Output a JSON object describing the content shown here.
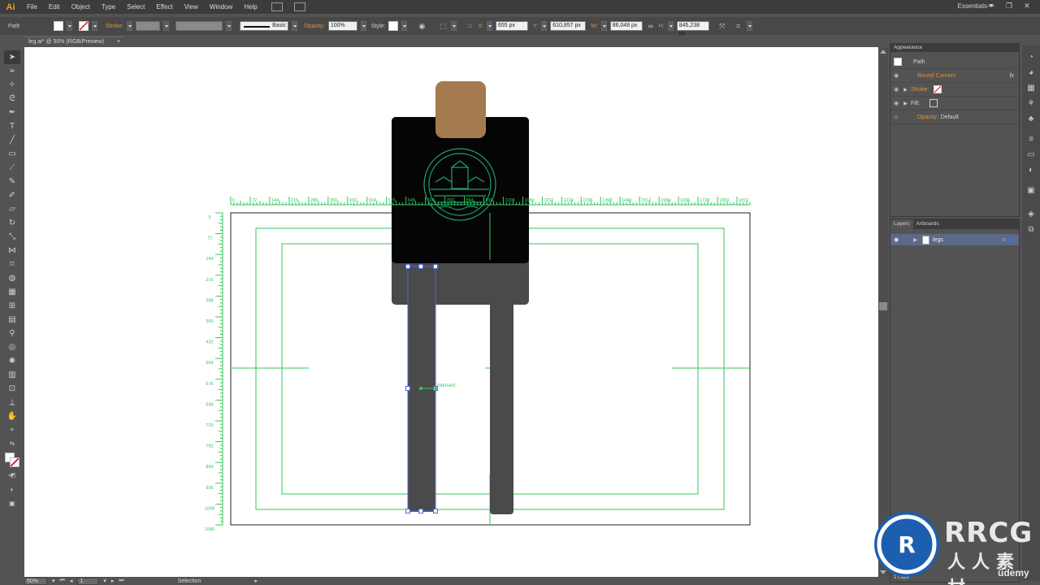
{
  "app": {
    "logo": "Ai",
    "workspace": "Essentials"
  },
  "menu": [
    "File",
    "Edit",
    "Object",
    "Type",
    "Select",
    "Effect",
    "View",
    "Window",
    "Help"
  ],
  "control": {
    "selection_type": "Path",
    "stroke_label": "Stroke:",
    "stroke_profile": "Basic",
    "opacity_label": "Opacity:",
    "opacity_value": "100%",
    "style_label": "Style:",
    "x_label": "X:",
    "x_value": "655 px",
    "y_label": "Y:",
    "y_value": "610,857 px",
    "w_label": "W:",
    "w_value": "86,048 px",
    "h_label": "H:",
    "h_value": "845,238 px"
  },
  "document": {
    "tab_title": "leg.ai* @ 50% (RGB/Preview)",
    "close": "×"
  },
  "ruler": {
    "top_ticks": [
      "0",
      "72",
      "144",
      "216",
      "288",
      "360",
      "432",
      "504",
      "576",
      "648",
      "720",
      "792",
      "864",
      "936",
      "1008",
      "1080",
      "1152",
      "1224",
      "1296",
      "1368",
      "1440",
      "1512",
      "1584",
      "1656",
      "1728",
      "1800",
      "1872"
    ],
    "left_ticks": [
      "0",
      "72",
      "144",
      "216",
      "288",
      "360",
      "432",
      "504",
      "576",
      "648",
      "720",
      "792",
      "864",
      "936",
      "1008",
      "1080"
    ],
    "smart_guide": "intersect"
  },
  "colors": {
    "guide_green": "#34c759",
    "shirt": "#050505",
    "skin": "#a57a4f",
    "pants": "#4a4a4a",
    "emblem": "#1ea371",
    "selection_blue": "#4a6bd6",
    "accent_orange": "#e0913c"
  },
  "appearance": {
    "title": "Appearance",
    "rows": [
      {
        "label": "Path"
      },
      {
        "label": "Round Corners",
        "fx": "fx"
      },
      {
        "label": "Stroke:"
      },
      {
        "label": "Fill:"
      },
      {
        "label": "Opacity:",
        "value": "Default"
      }
    ]
  },
  "layers": {
    "tab1": "Layers",
    "tab2": "Artboards",
    "layer_name": "legs",
    "footer": "1 Layer"
  },
  "status": {
    "zoom": "50%",
    "artboard": "1",
    "tool": "Selection"
  },
  "watermark": {
    "brand": "RRCG",
    "sub": "人人素材",
    "udemy": "ûdemy"
  }
}
